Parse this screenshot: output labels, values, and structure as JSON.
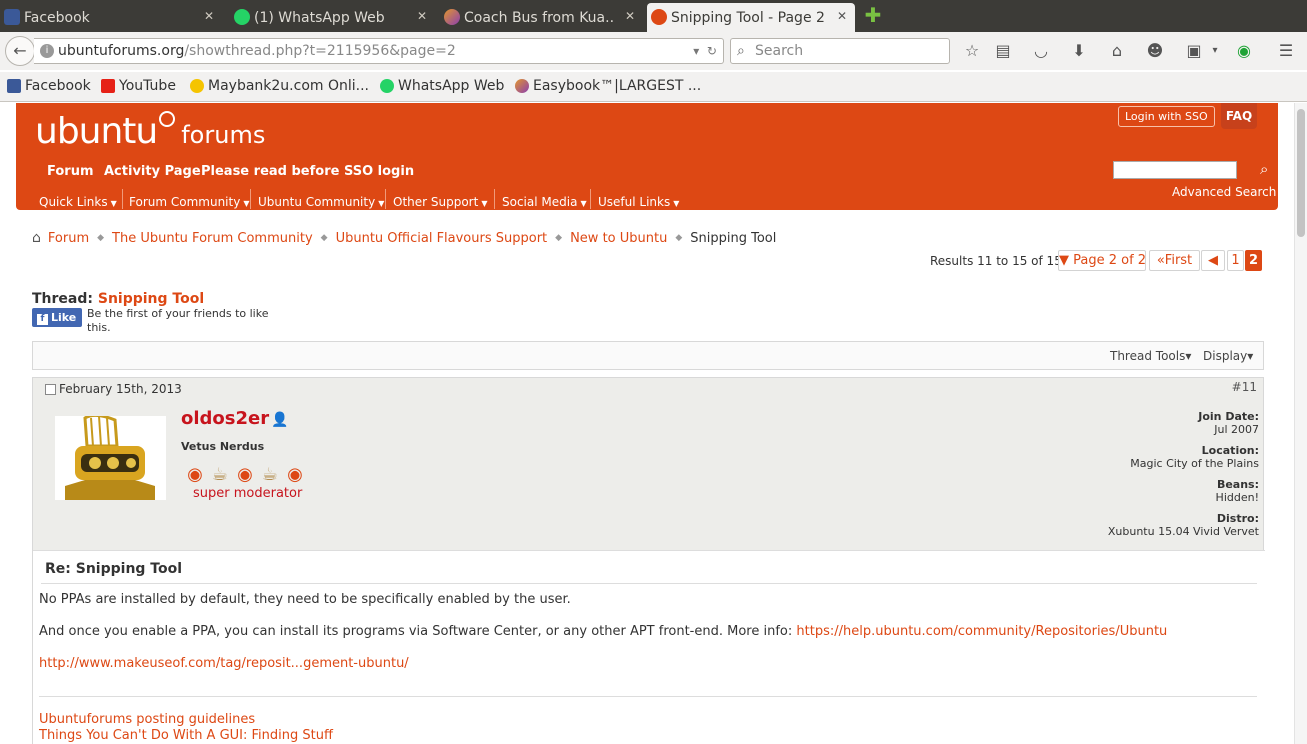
{
  "browser": {
    "tabs": [
      {
        "title": "Facebook",
        "icon": "facebook-icon",
        "color": "#3b5998"
      },
      {
        "title": "(1) WhatsApp Web",
        "icon": "whatsapp-icon",
        "color": "#25d366"
      },
      {
        "title": "Coach Bus from Kua...",
        "icon": "easybook-icon",
        "color": "#e2962d"
      },
      {
        "title": "Snipping Tool - Page 2",
        "icon": "ubuntu-icon",
        "color": "#dd4814"
      }
    ],
    "url_host": "ubuntuforums.org",
    "url_path": "/showthread.php?t=2115956&page=2",
    "search_placeholder": "Search",
    "bookmarks": [
      {
        "label": "Facebook",
        "icon": "facebook-icon",
        "color": "#3b5998"
      },
      {
        "label": "YouTube",
        "icon": "youtube-icon",
        "color": "#e62117"
      },
      {
        "label": "Maybank2u.com Onli...",
        "icon": "maybank-icon",
        "color": "#f5c400"
      },
      {
        "label": "WhatsApp Web",
        "icon": "whatsapp-icon",
        "color": "#25d366"
      },
      {
        "label": "Easybook™|LARGEST ...",
        "icon": "easybook-icon",
        "color": "#e2962d"
      }
    ]
  },
  "site": {
    "logo_main": "ubuntu",
    "logo_sub": "forums",
    "login_sso": "Login with SSO",
    "faq": "FAQ",
    "nav": [
      "Forum",
      "Activity Page",
      "Please read before SSO login"
    ],
    "advanced_search": "Advanced Search",
    "menu": [
      "Quick Links",
      "Forum Community",
      "Ubuntu Community",
      "Other Support",
      "Social Media",
      "Useful Links"
    ],
    "brand_color": "#dd4814"
  },
  "breadcrumb": [
    "Forum",
    "The Ubuntu Forum Community",
    "Ubuntu Official Flavours Support",
    "New to Ubuntu",
    "Snipping Tool"
  ],
  "pagination": {
    "results": "Results 11 to 15 of 15",
    "page_of": "Page 2 of 2",
    "first": "First",
    "pages": [
      "1",
      "2"
    ],
    "current_page": "2"
  },
  "thread": {
    "label": "Thread:",
    "title": "Snipping Tool",
    "like": "Like",
    "like_text": "Be the first of your friends to like this.",
    "tools": "Thread Tools",
    "display": "Display"
  },
  "post": {
    "date": "February 15th, 2013",
    "number": "#11",
    "username": "oldos2er",
    "user_title": "Vetus Nerdus",
    "rank": "super moderator",
    "join_label": "Join Date:",
    "join_value": "Jul 2007",
    "location_label": "Location:",
    "location_value": "Magic City of the Plains",
    "beans_label": "Beans:",
    "beans_value": "Hidden!",
    "distro_label": "Distro:",
    "distro_value": "Xubuntu 15.04 Vivid Vervet",
    "title": "Re: Snipping Tool",
    "line1": "No PPAs are installed by default, they need to be specifically enabled by the user.",
    "line2": "And once you enable a PPA, you can install its programs via Software Center, or any other APT front-end. More info:",
    "line2_link": "https://help.ubuntu.com/community/Repositories/Ubuntu",
    "line3_link": "http://www.makeuseof.com/tag/reposit...gement-ubuntu/",
    "sig1": "Ubuntuforums posting guidelines",
    "sig2": "Things You Can't Do With A GUI: Finding Stuff"
  }
}
